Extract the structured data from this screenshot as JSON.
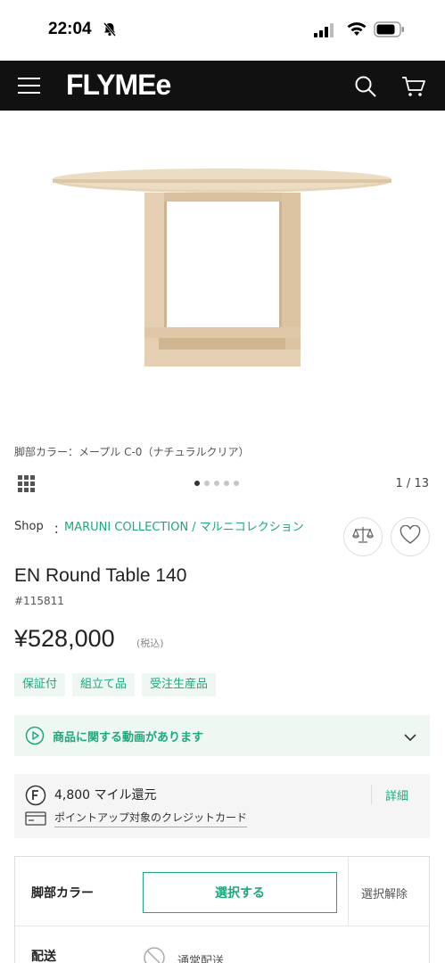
{
  "status_bar": {
    "time": "22:04"
  },
  "header": {
    "logo": "FLYMEe"
  },
  "product": {
    "color_caption": "脚部カラー：メープル C-0（ナチュラルクリア）",
    "gallery_counter": "1 / 13",
    "gallery_dots_total": 5,
    "gallery_dots_active": 1,
    "shop_label": "Shop",
    "shop_colon": "：",
    "shop_name": "MARUNI COLLECTION / マルニコレクション",
    "title": "EN Round Table 140",
    "id": "#115811",
    "price": "¥528,000",
    "tax_note": "(税込)",
    "tags": [
      "保証付",
      "組立て品",
      "受注生産品"
    ]
  },
  "video": {
    "text": "商品に関する動画があります"
  },
  "miles": {
    "text": "4,800 マイル還元",
    "detail_label": "詳細",
    "card_text": "ポイントアップ対象のクレジットカード"
  },
  "options": {
    "leg_color_label": "脚部カラー",
    "select_label": "選択する",
    "clear_label": "選択解除",
    "delivery_label": "配送",
    "delivery_value": "通常配送"
  },
  "colors": {
    "accent": "#1fa87c",
    "header_bg": "#111111",
    "tag_bg": "#eef7f2",
    "wood": "#e2cdb0"
  }
}
